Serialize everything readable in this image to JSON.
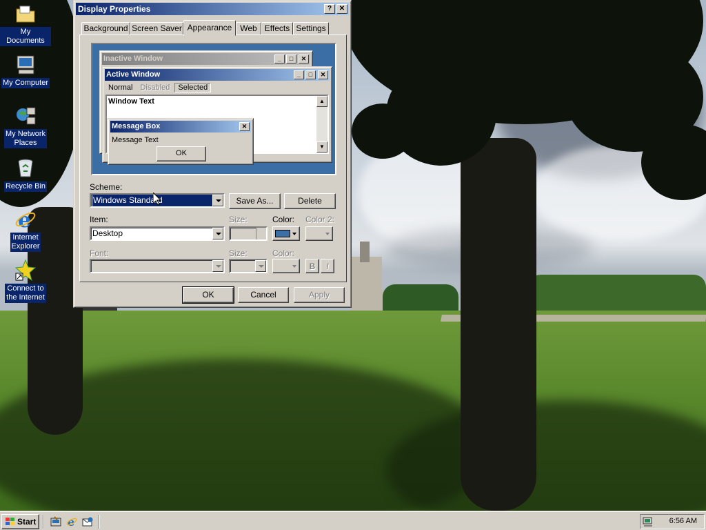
{
  "desktop": {
    "icons": [
      {
        "label_line1": "My Documents",
        "label_line2": ""
      },
      {
        "label_line1": "My Computer",
        "label_line2": ""
      },
      {
        "label_line1": "My Network",
        "label_line2": "Places"
      },
      {
        "label_line1": "Recycle Bin",
        "label_line2": ""
      },
      {
        "label_line1": "Internet",
        "label_line2": "Explorer"
      },
      {
        "label_line1": "Connect to",
        "label_line2": "the Internet"
      }
    ]
  },
  "dialog": {
    "title": "Display Properties",
    "help_glyph": "?",
    "close_glyph": "✕",
    "tabs": [
      "Background",
      "Screen Saver",
      "Appearance",
      "Web",
      "Effects",
      "Settings"
    ],
    "active_tab": "Appearance",
    "preview": {
      "inactive_title": "Inactive Window",
      "active_title": "Active Window",
      "menu": [
        "Normal",
        "Disabled",
        "Selected"
      ],
      "window_text": "Window Text",
      "msgbox_title": "Message Box",
      "msgbox_text": "Message Text",
      "msgbox_ok": "OK"
    },
    "scheme_label": "Scheme:",
    "scheme_value": "Windows Standard",
    "save_as_label": "Save As...",
    "delete_label": "Delete",
    "item_label": "Item:",
    "item_value": "Desktop",
    "size_label": "Size:",
    "color_label": "Color:",
    "color2_label": "Color 2:",
    "font_label": "Font:",
    "font_size_label": "Size:",
    "font_color_label": "Color:",
    "bold_label": "B",
    "italic_label": "I",
    "ok_label": "OK",
    "cancel_label": "Cancel",
    "apply_label": "Apply",
    "desktop_color": "#3a6ea5"
  },
  "taskbar": {
    "start_label": "Start",
    "clock": "6:56 AM"
  }
}
